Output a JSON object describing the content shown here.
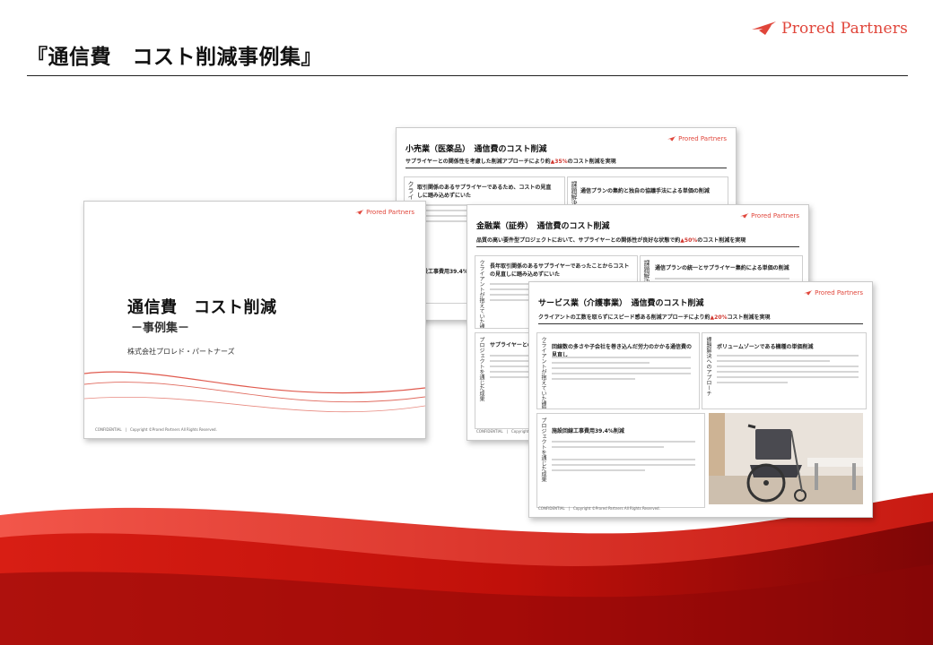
{
  "brand": {
    "name": "Prored Partners",
    "color": "#e0453a"
  },
  "page": {
    "title": "『通信費　コスト削減事例集』"
  },
  "slides": {
    "cover": {
      "logo": "Prored Partners",
      "title": "通信費　コスト削減",
      "subtitle": "－事例集－",
      "company": "株式会社プロレド・パートナーズ",
      "footer": "CONFIDENTIAL　|　Copyright ©Prored Partners All Rights Reserved."
    },
    "retail": {
      "logo": "Prored Partners",
      "heading": "小売業（医薬品）　通信費のコスト削減",
      "subtitle_pre": "サプライヤーとの関係性を考慮した削減アプローチにより約",
      "subtitle_pct": "▲35%",
      "subtitle_post": "のコスト削減を実現",
      "box1_title": "取引関係のあるサプライヤーであるため、コストの見直しに踏み込めずにいた",
      "box2_title": "通信プランの集約と独自の協議手法による単価の削減",
      "label_client": "クライアント",
      "label_issue": "課題解決",
      "box3_title": "施設工事費用39.4%"
    },
    "finance": {
      "logo": "Prored Partners",
      "heading": "金融業（証券）　通信費のコスト削減",
      "subtitle_pre": "品質の高い要件型プロジェクトにおいて、サプライヤーとの関係性が良好な状態で約",
      "subtitle_pct": "▲50%",
      "subtitle_post": "のコスト削減を実現",
      "box1_title": "長年取引関係のあるサプライヤーであったことからコストの見直しに踏み込めずにいた",
      "box2_title": "通信プランの統一とサプライヤー集約による単価の削減",
      "label_client": "クライアントが抱えていた課題",
      "label_issue": "課題解決",
      "box3_title": "サプライヤーとの関",
      "label_project": "プロジェクトを通じた成果",
      "footer": "CONFIDENTIAL　|　Copyright ©"
    },
    "service": {
      "logo": "Prored Partners",
      "heading": "サービス業（介護事業）　通信費のコスト削減",
      "subtitle_pre": "クライアントの工数を取らずにスピード感ある削減アプローチにより約",
      "subtitle_pct": "▲20%",
      "subtitle_post": "コスト削減を実現",
      "label_client": "クライアントが抱えていた課題",
      "box1_title": "回線数の多さや子会社を巻き込んだ労力のかかる通信費の見直し",
      "label_approach": "課題解決へのアプローチ",
      "box2_title": "ボリュームゾーンである機種の単価削減",
      "label_project": "プロジェクトを通じた成果",
      "box3_title": "施設回線工事費用39.4%削減",
      "footer": "CONFIDENTIAL　|　Copyright ©Prored Partners All Rights Reserved."
    }
  }
}
